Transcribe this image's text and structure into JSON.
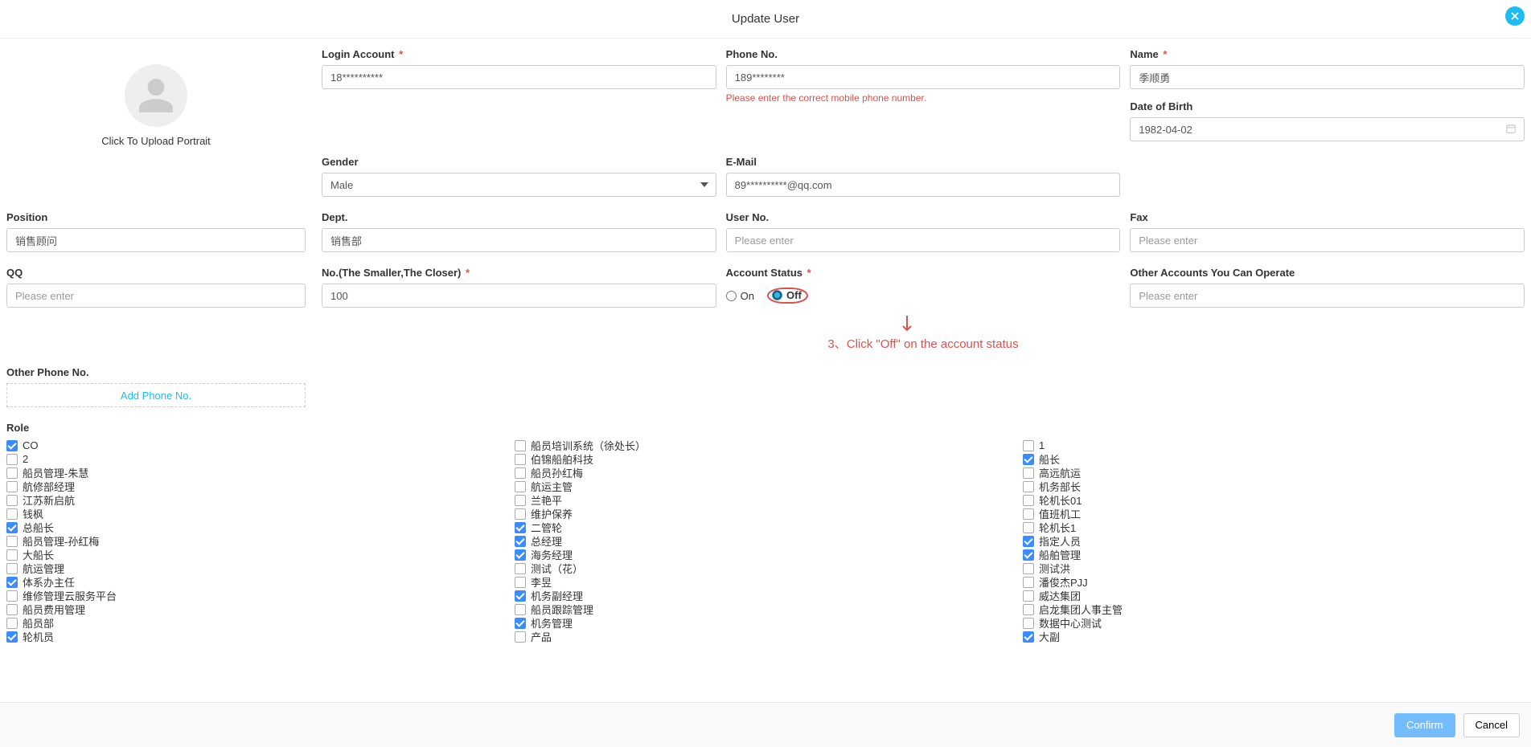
{
  "title": "Update User",
  "portrait": {
    "upload_text": "Click To Upload Portrait"
  },
  "fields": {
    "login": {
      "label": "Login Account",
      "value": "18**********"
    },
    "phone": {
      "label": "Phone No.",
      "value": "189********",
      "error": "Please enter the correct mobile phone number."
    },
    "name": {
      "label": "Name",
      "value": "季顺勇"
    },
    "dob": {
      "label": "Date of Birth",
      "value": "1982-04-02"
    },
    "gender": {
      "label": "Gender",
      "value": "Male"
    },
    "email": {
      "label": "E-Mail",
      "value": "89**********@qq.com"
    },
    "position": {
      "label": "Position",
      "value": "销售顾问"
    },
    "dept": {
      "label": "Dept.",
      "value": "销售部"
    },
    "userno": {
      "label": "User No.",
      "placeholder": "Please enter"
    },
    "fax": {
      "label": "Fax",
      "placeholder": "Please enter"
    },
    "qq": {
      "label": "QQ",
      "placeholder": "Please enter"
    },
    "no": {
      "label": "No.(The Smaller,The Closer)",
      "value": "100"
    },
    "status": {
      "label": "Account Status",
      "on": "On",
      "off": "Off",
      "selected": "Off"
    },
    "otheracc": {
      "label": "Other Accounts You Can Operate",
      "placeholder": "Please enter"
    },
    "otherphone": {
      "label": "Other Phone No.",
      "add": "Add Phone No."
    },
    "role": {
      "label": "Role"
    }
  },
  "annotation": "3、Click \"Off\" on the account status",
  "roles_col1": [
    {
      "label": "CO",
      "checked": true
    },
    {
      "label": "2",
      "checked": false
    },
    {
      "label": "船员管理-朱慧",
      "checked": false
    },
    {
      "label": "航修部经理",
      "checked": false
    },
    {
      "label": "江苏新启航",
      "checked": false
    },
    {
      "label": "钱枫",
      "checked": false
    },
    {
      "label": "总船长",
      "checked": true
    },
    {
      "label": "船员管理-孙红梅",
      "checked": false
    },
    {
      "label": "大船长",
      "checked": false
    },
    {
      "label": "航运管理",
      "checked": false
    },
    {
      "label": "体系办主任",
      "checked": true
    },
    {
      "label": "维修管理云服务平台",
      "checked": false
    },
    {
      "label": "船员费用管理",
      "checked": false
    },
    {
      "label": "船员部",
      "checked": false
    },
    {
      "label": "轮机员",
      "checked": true
    }
  ],
  "roles_col2": [
    {
      "label": "船员培训系统（徐处长）",
      "checked": false
    },
    {
      "label": "伯锦船舶科技",
      "checked": false
    },
    {
      "label": "船员孙红梅",
      "checked": false
    },
    {
      "label": "航运主管",
      "checked": false
    },
    {
      "label": "兰艳平",
      "checked": false
    },
    {
      "label": "维护保养",
      "checked": false
    },
    {
      "label": "二管轮",
      "checked": true
    },
    {
      "label": "总经理",
      "checked": true
    },
    {
      "label": "海务经理",
      "checked": true
    },
    {
      "label": "测试（花）",
      "checked": false
    },
    {
      "label": "李昱",
      "checked": false
    },
    {
      "label": "机务副经理",
      "checked": true
    },
    {
      "label": "船员跟踪管理",
      "checked": false
    },
    {
      "label": "机务管理",
      "checked": true
    },
    {
      "label": "产品",
      "checked": false
    }
  ],
  "roles_col3": [
    {
      "label": "1",
      "checked": false
    },
    {
      "label": "船长",
      "checked": true
    },
    {
      "label": "高远航运",
      "checked": false
    },
    {
      "label": "机务部长",
      "checked": false
    },
    {
      "label": "轮机长01",
      "checked": false
    },
    {
      "label": "值班机工",
      "checked": false
    },
    {
      "label": "轮机长1",
      "checked": false
    },
    {
      "label": "指定人员",
      "checked": true
    },
    {
      "label": "船舶管理",
      "checked": true
    },
    {
      "label": "测试洪",
      "checked": false
    },
    {
      "label": "潘俊杰PJJ",
      "checked": false
    },
    {
      "label": "威达集团",
      "checked": false
    },
    {
      "label": "启龙集团人事主管",
      "checked": false
    },
    {
      "label": "数据中心测试",
      "checked": false
    },
    {
      "label": "大副",
      "checked": true
    }
  ],
  "footer": {
    "confirm": "Confirm",
    "cancel": "Cancel"
  }
}
